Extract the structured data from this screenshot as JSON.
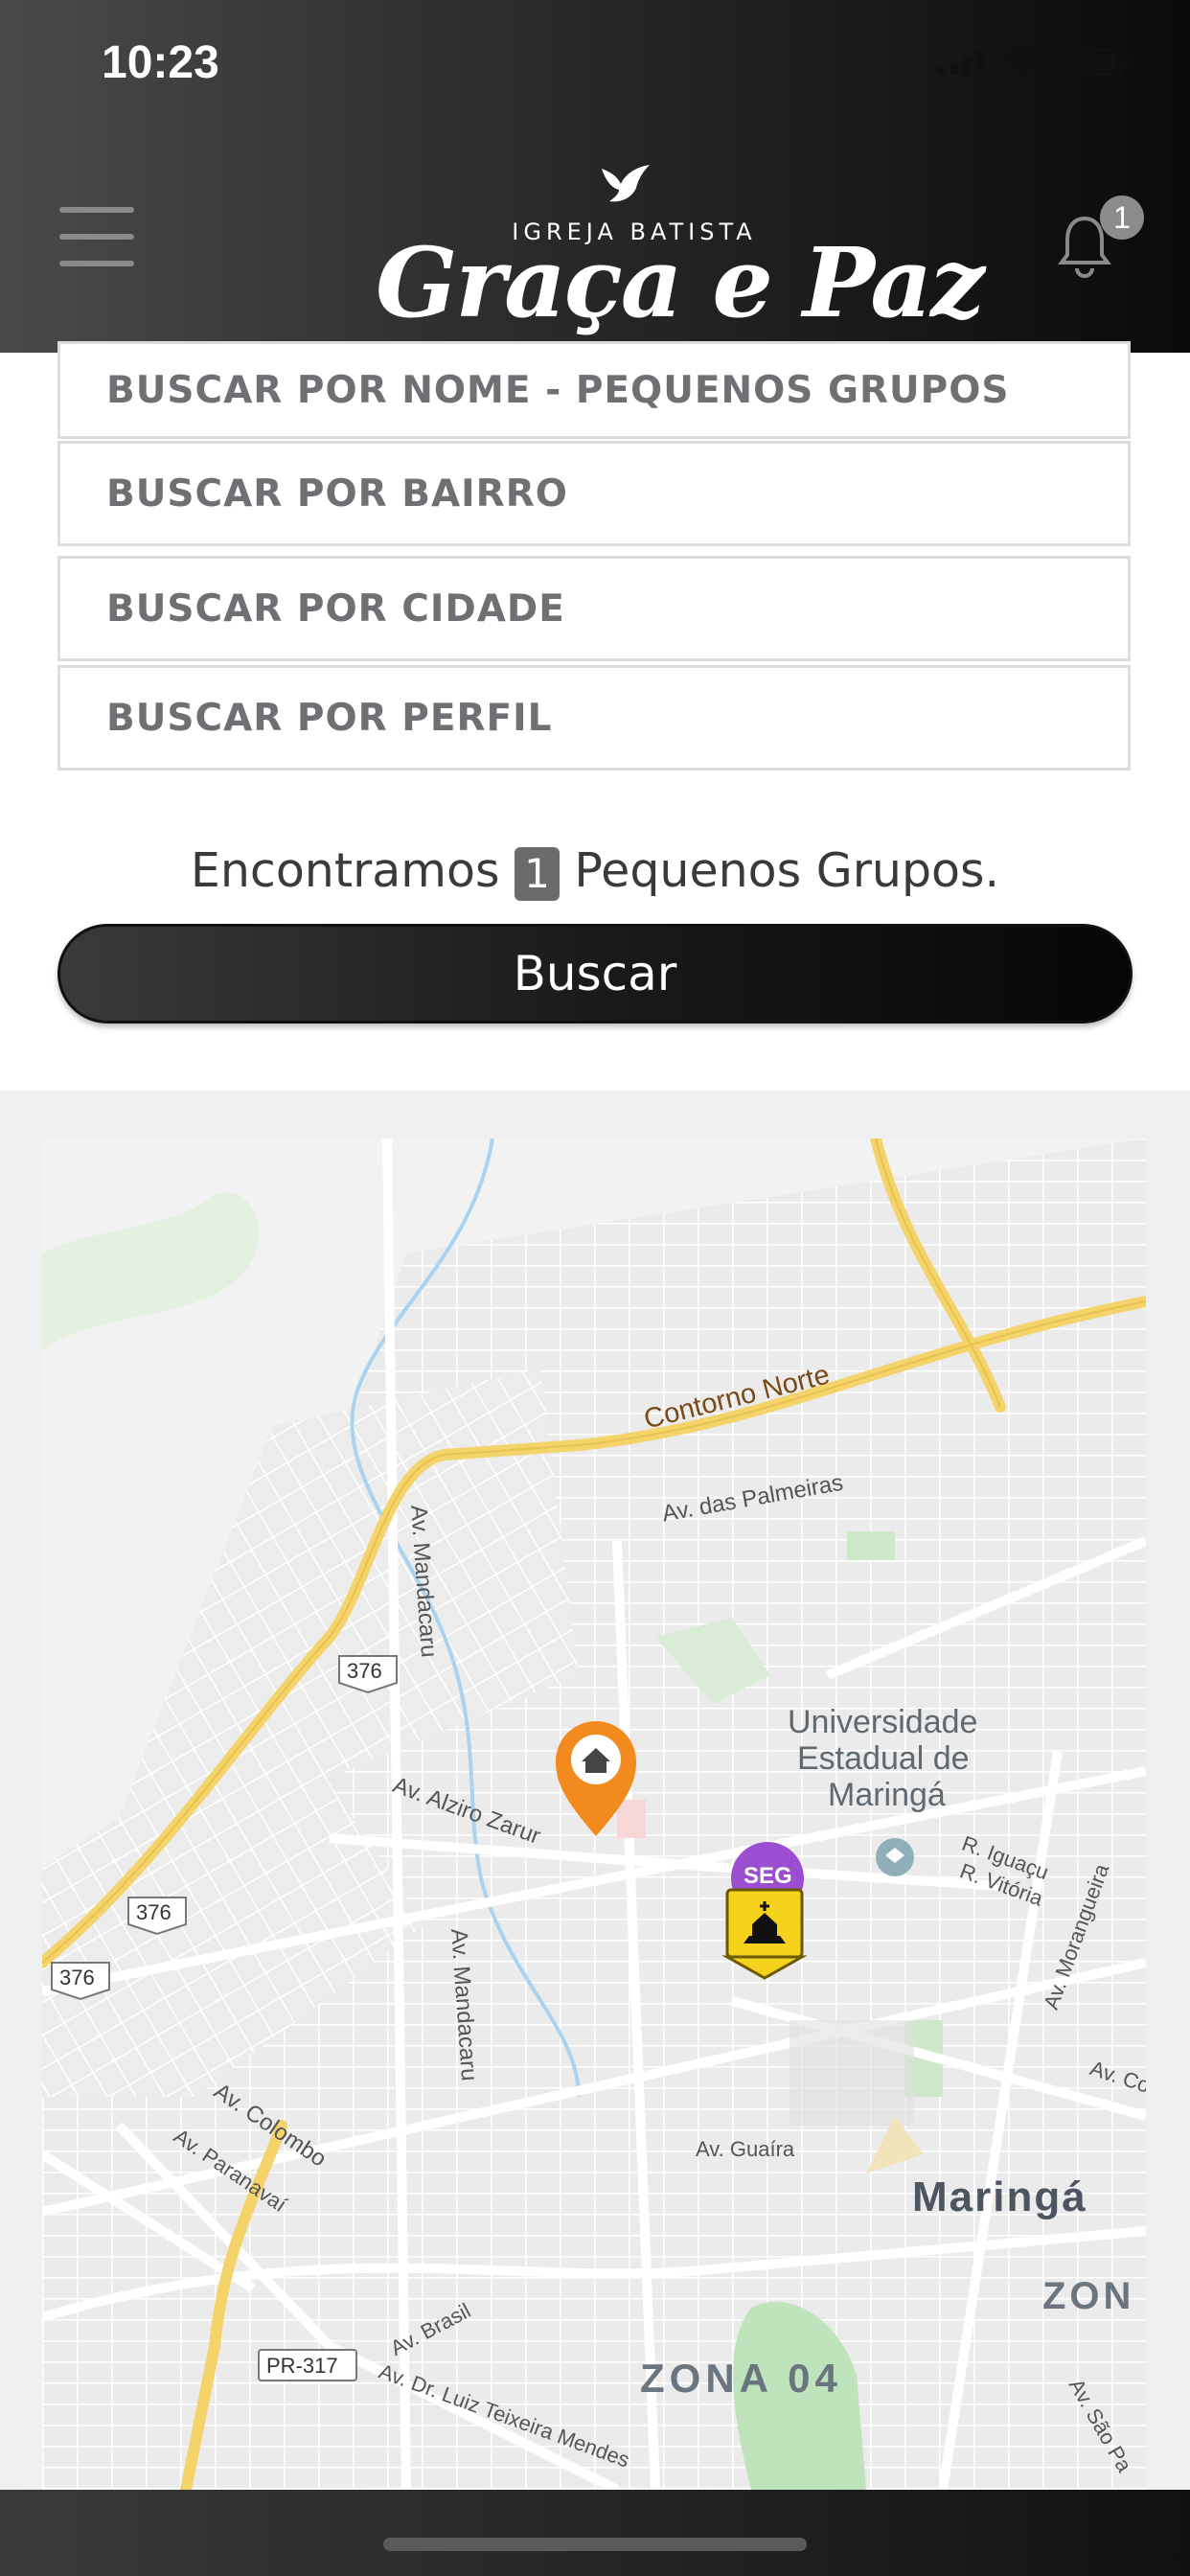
{
  "status_bar": {
    "time": "10:23"
  },
  "header": {
    "logo_top": "IGREJA BATISTA",
    "logo_main": "Graça e Paz",
    "notification_count": "1"
  },
  "search": {
    "buttons": [
      "BUSCAR POR NOME - PEQUENOS GRUPOS",
      "BUSCAR POR BAIRRO",
      "BUSCAR POR CIDADE",
      "BUSCAR POR PERFIL"
    ],
    "results_prefix": "Encontramos",
    "results_count": "1",
    "results_suffix": "Pequenos Grupos.",
    "submit_label": "Buscar"
  },
  "map": {
    "labels": {
      "contorno_norte": "Contorno Norte",
      "av_palmeiras": "Av. das Palmeiras",
      "av_mandacaru_1": "Av. Mandacaru",
      "av_mandacaru_2": "Av. Mandacaru",
      "av_alziro_zarur": "Av. Alziro Zarur",
      "universidade": "Universidade",
      "estadual": "Estadual de",
      "maringa_uni": "Maringá",
      "r_iguacu": "R. Iguaçu",
      "r_vitoria": "R. Vitória",
      "av_morangueira": "Av. Morangueira",
      "av_colombo_right": "Av. Colom",
      "av_colombo": "Av. Colombo",
      "av_paranavai": "Av. Paranavaí",
      "av_guaira": "Av. Guaíra",
      "maringa_city": "Maringá",
      "zona": "ZON",
      "zona_04": "ZONA 04",
      "av_brasil": "Av. Brasil",
      "av_luiz": "Av. Dr. Luiz Teixeira Mendes",
      "av_sao_paulo": "Av. São Pa",
      "shield_376_a": "376",
      "shield_376_b": "376",
      "shield_376_c": "376",
      "pr_317": "PR-317",
      "marker_day": "SEG"
    }
  }
}
